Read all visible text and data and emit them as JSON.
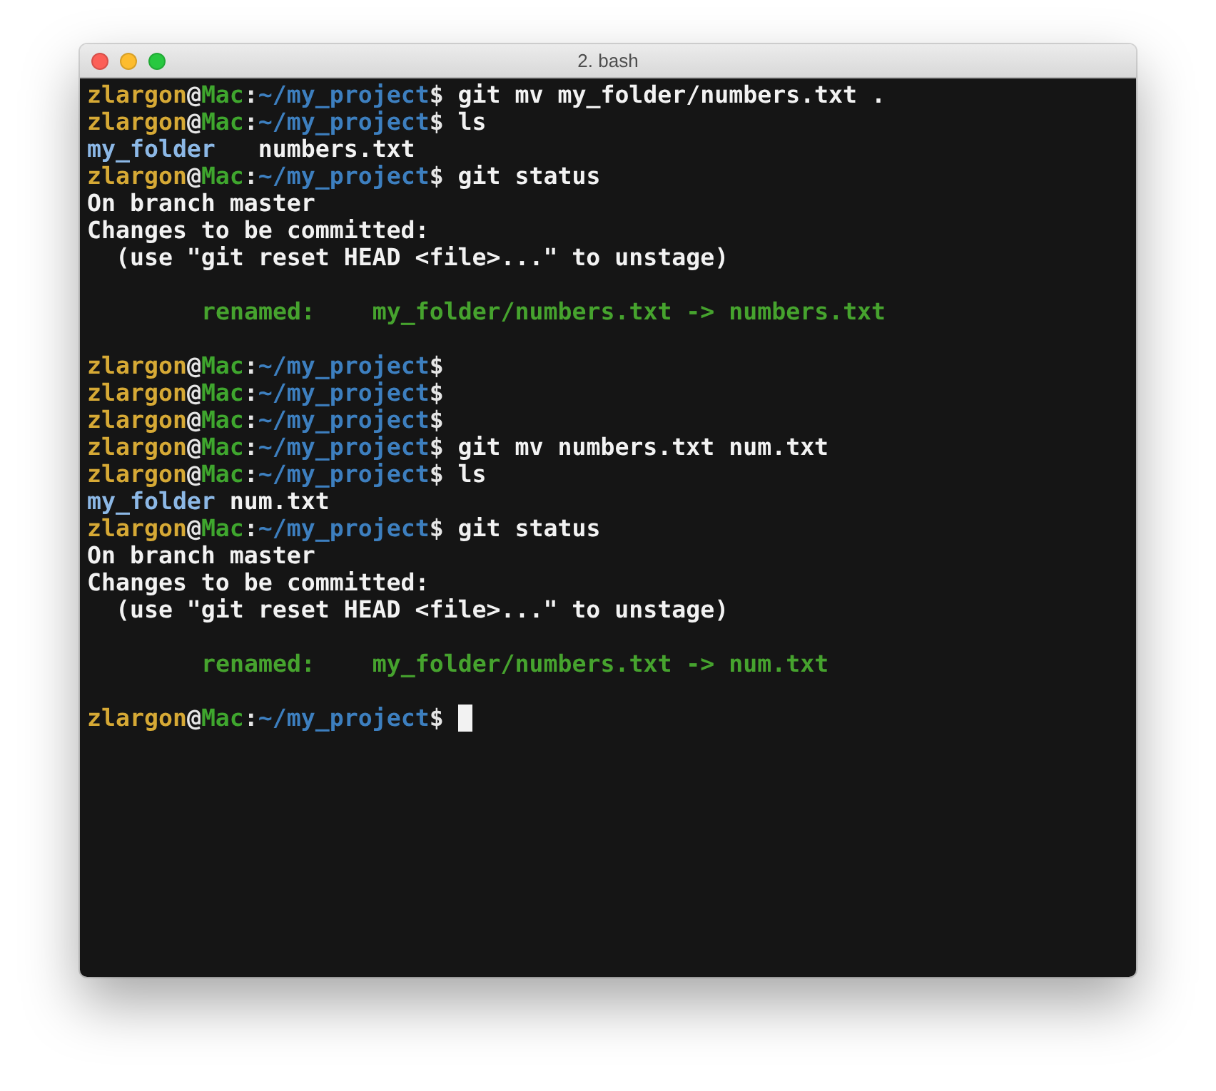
{
  "window": {
    "title": "2. bash"
  },
  "lines": [
    {
      "kind": "text",
      "segments": [
        {
          "kind": "user",
          "text": "zlargon"
        },
        {
          "kind": "sep",
          "text": "@"
        },
        {
          "kind": "host",
          "text": "Mac"
        },
        {
          "kind": "sep",
          "text": ":"
        },
        {
          "kind": "path",
          "text": "~/my_project"
        },
        {
          "kind": "sep",
          "text": "$"
        },
        {
          "kind": "plain",
          "text": " git mv my_folder/numbers.txt ."
        }
      ]
    },
    {
      "kind": "text",
      "segments": [
        {
          "kind": "user",
          "text": "zlargon"
        },
        {
          "kind": "sep",
          "text": "@"
        },
        {
          "kind": "host",
          "text": "Mac"
        },
        {
          "kind": "sep",
          "text": ":"
        },
        {
          "kind": "path",
          "text": "~/my_project"
        },
        {
          "kind": "sep",
          "text": "$"
        },
        {
          "kind": "plain",
          "text": " ls"
        }
      ]
    },
    {
      "kind": "text",
      "segments": [
        {
          "kind": "dir",
          "text": "my_folder"
        },
        {
          "kind": "plain",
          "text": "   numbers.txt"
        }
      ]
    },
    {
      "kind": "text",
      "segments": [
        {
          "kind": "user",
          "text": "zlargon"
        },
        {
          "kind": "sep",
          "text": "@"
        },
        {
          "kind": "host",
          "text": "Mac"
        },
        {
          "kind": "sep",
          "text": ":"
        },
        {
          "kind": "path",
          "text": "~/my_project"
        },
        {
          "kind": "sep",
          "text": "$"
        },
        {
          "kind": "plain",
          "text": " git status"
        }
      ]
    },
    {
      "kind": "text",
      "segments": [
        {
          "kind": "plain",
          "text": "On branch master"
        }
      ]
    },
    {
      "kind": "text",
      "segments": [
        {
          "kind": "plain",
          "text": "Changes to be committed:"
        }
      ]
    },
    {
      "kind": "text",
      "segments": [
        {
          "kind": "plain",
          "text": "  (use \"git reset HEAD <file>...\" to unstage)"
        }
      ]
    },
    {
      "kind": "blank"
    },
    {
      "kind": "text",
      "indented": true,
      "segments": [
        {
          "kind": "renamed",
          "text": "renamed:    my_folder/numbers.txt -> numbers.txt"
        }
      ]
    },
    {
      "kind": "blank"
    },
    {
      "kind": "text",
      "segments": [
        {
          "kind": "user",
          "text": "zlargon"
        },
        {
          "kind": "sep",
          "text": "@"
        },
        {
          "kind": "host",
          "text": "Mac"
        },
        {
          "kind": "sep",
          "text": ":"
        },
        {
          "kind": "path",
          "text": "~/my_project"
        },
        {
          "kind": "sep",
          "text": "$"
        }
      ]
    },
    {
      "kind": "text",
      "segments": [
        {
          "kind": "user",
          "text": "zlargon"
        },
        {
          "kind": "sep",
          "text": "@"
        },
        {
          "kind": "host",
          "text": "Mac"
        },
        {
          "kind": "sep",
          "text": ":"
        },
        {
          "kind": "path",
          "text": "~/my_project"
        },
        {
          "kind": "sep",
          "text": "$"
        }
      ]
    },
    {
      "kind": "text",
      "segments": [
        {
          "kind": "user",
          "text": "zlargon"
        },
        {
          "kind": "sep",
          "text": "@"
        },
        {
          "kind": "host",
          "text": "Mac"
        },
        {
          "kind": "sep",
          "text": ":"
        },
        {
          "kind": "path",
          "text": "~/my_project"
        },
        {
          "kind": "sep",
          "text": "$"
        }
      ]
    },
    {
      "kind": "text",
      "segments": [
        {
          "kind": "user",
          "text": "zlargon"
        },
        {
          "kind": "sep",
          "text": "@"
        },
        {
          "kind": "host",
          "text": "Mac"
        },
        {
          "kind": "sep",
          "text": ":"
        },
        {
          "kind": "path",
          "text": "~/my_project"
        },
        {
          "kind": "sep",
          "text": "$"
        },
        {
          "kind": "plain",
          "text": " git mv numbers.txt num.txt"
        }
      ]
    },
    {
      "kind": "text",
      "segments": [
        {
          "kind": "user",
          "text": "zlargon"
        },
        {
          "kind": "sep",
          "text": "@"
        },
        {
          "kind": "host",
          "text": "Mac"
        },
        {
          "kind": "sep",
          "text": ":"
        },
        {
          "kind": "path",
          "text": "~/my_project"
        },
        {
          "kind": "sep",
          "text": "$"
        },
        {
          "kind": "plain",
          "text": " ls"
        }
      ]
    },
    {
      "kind": "text",
      "segments": [
        {
          "kind": "dir",
          "text": "my_folder"
        },
        {
          "kind": "plain",
          "text": " num.txt"
        }
      ]
    },
    {
      "kind": "text",
      "segments": [
        {
          "kind": "user",
          "text": "zlargon"
        },
        {
          "kind": "sep",
          "text": "@"
        },
        {
          "kind": "host",
          "text": "Mac"
        },
        {
          "kind": "sep",
          "text": ":"
        },
        {
          "kind": "path",
          "text": "~/my_project"
        },
        {
          "kind": "sep",
          "text": "$"
        },
        {
          "kind": "plain",
          "text": " git status"
        }
      ]
    },
    {
      "kind": "text",
      "segments": [
        {
          "kind": "plain",
          "text": "On branch master"
        }
      ]
    },
    {
      "kind": "text",
      "segments": [
        {
          "kind": "plain",
          "text": "Changes to be committed:"
        }
      ]
    },
    {
      "kind": "text",
      "segments": [
        {
          "kind": "plain",
          "text": "  (use \"git reset HEAD <file>...\" to unstage)"
        }
      ]
    },
    {
      "kind": "blank"
    },
    {
      "kind": "text",
      "indented": true,
      "segments": [
        {
          "kind": "renamed",
          "text": "renamed:    my_folder/numbers.txt -> num.txt"
        }
      ]
    },
    {
      "kind": "blank"
    },
    {
      "kind": "text",
      "cursor": true,
      "segments": [
        {
          "kind": "user",
          "text": "zlargon"
        },
        {
          "kind": "sep",
          "text": "@"
        },
        {
          "kind": "host",
          "text": "Mac"
        },
        {
          "kind": "sep",
          "text": ":"
        },
        {
          "kind": "path",
          "text": "~/my_project"
        },
        {
          "kind": "sep",
          "text": "$"
        }
      ]
    }
  ]
}
